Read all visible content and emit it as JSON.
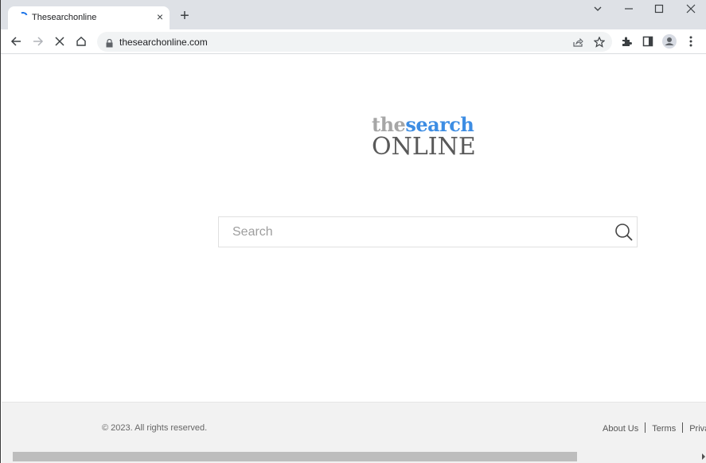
{
  "browser": {
    "tab": {
      "title": "Thesearchonline",
      "close_label": "×"
    },
    "new_tab_label": "+",
    "window_controls": {
      "dropdown": "⌄",
      "minimize": "—",
      "maximize": "☐",
      "close": "✕"
    },
    "address_bar": {
      "url": "thesearchonline.com"
    },
    "toolbar_icons": [
      "back-icon",
      "forward-icon",
      "stop-icon",
      "home-icon",
      "lock-icon",
      "share-icon",
      "star-icon",
      "extensions-icon",
      "side-panel-icon",
      "profile-icon",
      "menu-icon"
    ]
  },
  "page": {
    "logo": {
      "line1_a": "the",
      "line1_b": "search",
      "line2": "ONLINE"
    },
    "search": {
      "placeholder": "Search",
      "value": ""
    },
    "footer": {
      "copyright": "© 2023. All rights reserved.",
      "links": [
        "About Us",
        "Terms",
        "Privacy"
      ]
    }
  },
  "colors": {
    "logo_gray": "#a6a6a6",
    "logo_blue": "#3d8de3",
    "logo_dark": "#595959"
  }
}
